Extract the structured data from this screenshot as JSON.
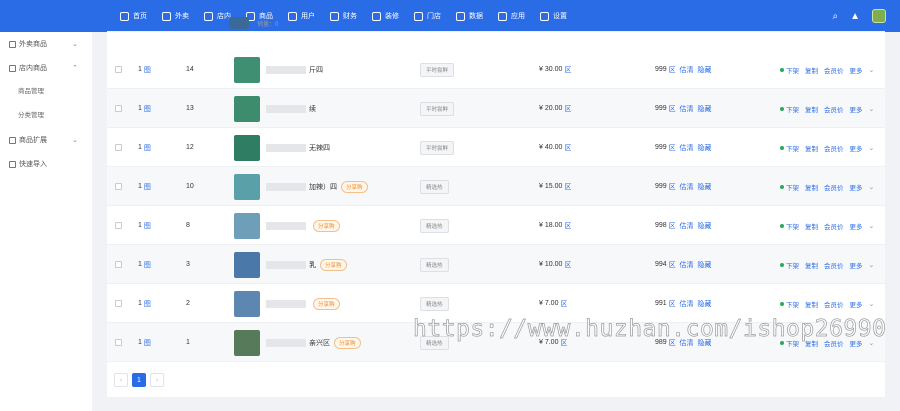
{
  "nav": [
    {
      "label": "首页",
      "icon": "home-icon"
    },
    {
      "label": "外卖",
      "icon": "takeout-icon"
    },
    {
      "label": "店内",
      "icon": "dine-in-icon"
    },
    {
      "label": "商品",
      "icon": "goods-icon"
    },
    {
      "label": "用户",
      "icon": "user-icon"
    },
    {
      "label": "财务",
      "icon": "finance-icon"
    },
    {
      "label": "装修",
      "icon": "decor-icon"
    },
    {
      "label": "门店",
      "icon": "store-icon"
    },
    {
      "label": "数据",
      "icon": "data-icon"
    },
    {
      "label": "应用",
      "icon": "apps-icon"
    },
    {
      "label": "设置",
      "icon": "settings-icon"
    }
  ],
  "sidebar": {
    "groups": [
      {
        "label": "外卖商品",
        "chevron": "⌄"
      },
      {
        "label": "店内商品",
        "chevron": "⌃"
      },
      {
        "label": "商品扩展",
        "chevron": "⌄"
      },
      {
        "label": "快速导入",
        "chevron": ""
      }
    ],
    "subs": [
      "商品管理",
      "分类管理"
    ]
  },
  "top_row_partial": {
    "label": "销量：0"
  },
  "rows": [
    {
      "col1": "1",
      "col1_icon": "图",
      "sort": "14",
      "name_suffix": "斤四",
      "tag": "",
      "cat": "平时尝鲜",
      "price": "¥ 30.00",
      "stock": "999",
      "edit": "估清",
      "hide": "隐藏"
    },
    {
      "col1": "1",
      "col1_icon": "图",
      "sort": "13",
      "name_suffix": "续",
      "tag": "",
      "cat": "平时尝鲜",
      "price": "¥ 20.00",
      "stock": "999",
      "edit": "估清",
      "hide": "隐藏"
    },
    {
      "col1": "1",
      "col1_icon": "图",
      "sort": "12",
      "name_suffix": "无辣四",
      "tag": "",
      "cat": "平时尝鲜",
      "price": "¥ 40.00",
      "stock": "999",
      "edit": "估清",
      "hide": "隐藏"
    },
    {
      "col1": "1",
      "col1_icon": "图",
      "sort": "10",
      "name_suffix": "加辣）四",
      "tag": "分享购",
      "cat": "精选热",
      "price": "¥ 15.00",
      "stock": "999",
      "edit": "估清",
      "hide": "隐藏"
    },
    {
      "col1": "1",
      "col1_icon": "图",
      "sort": "8",
      "name_suffix": "",
      "tag": "分享购",
      "cat": "精选热",
      "price": "¥ 18.00",
      "stock": "998",
      "edit": "估清",
      "hide": "隐藏"
    },
    {
      "col1": "1",
      "col1_icon": "图",
      "sort": "3",
      "name_suffix": "乳",
      "tag": "分享购",
      "cat": "精选热",
      "price": "¥ 10.00",
      "stock": "994",
      "edit": "估清",
      "hide": "隐藏"
    },
    {
      "col1": "1",
      "col1_icon": "图",
      "sort": "2",
      "name_suffix": "",
      "tag": "分享购",
      "cat": "精选热",
      "price": "¥ 7.00",
      "stock": "991",
      "edit": "估清",
      "hide": "隐藏"
    },
    {
      "col1": "1",
      "col1_icon": "图",
      "sort": "1",
      "name_suffix": "亲兴区",
      "tag": "分享购",
      "cat": "精选热",
      "price": "¥ 7.00",
      "stock": "989",
      "edit": "估清",
      "hide": "隐藏"
    }
  ],
  "ops": {
    "status": "下架",
    "copy": "复制",
    "sku_price": "会员价",
    "more": "更多",
    "icon_suffix": "区"
  },
  "pager": {
    "prev": "‹",
    "current": "1",
    "next": "›"
  },
  "watermark": "https://www.huzhan.com/ishop26990",
  "colors": {
    "primary": "#2a6ce6",
    "tag_orange": "#f08a24",
    "status_green": "#2fa85c"
  }
}
